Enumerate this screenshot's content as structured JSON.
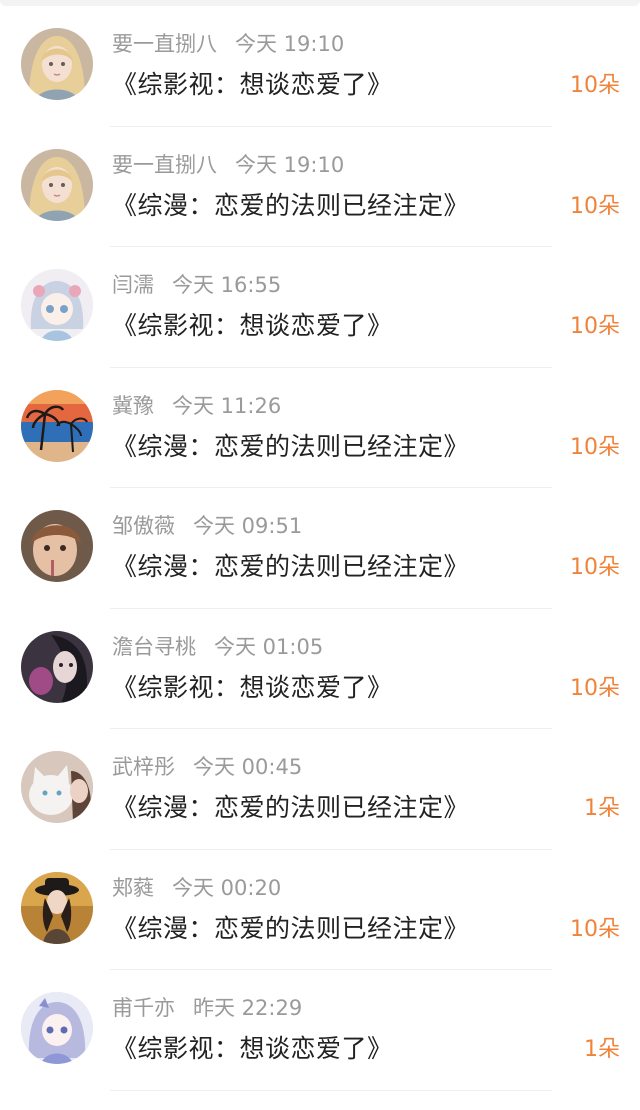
{
  "rows": [
    {
      "name": "要一直捌八",
      "time": "今天 19:10",
      "title": "《综影视：想谈恋爱了》",
      "gift": "10朵",
      "avatar": "avatar-girl-blonde"
    },
    {
      "name": "要一直捌八",
      "time": "今天 19:10",
      "title": "《综漫：恋爱的法则已经注定》",
      "gift": "10朵",
      "avatar": "avatar-girl-blonde"
    },
    {
      "name": "闫濡",
      "time": "今天 16:55",
      "title": "《综影视：想谈恋爱了》",
      "gift": "10朵",
      "avatar": "avatar-anime-girl"
    },
    {
      "name": "冀豫",
      "time": "今天 11:26",
      "title": "《综漫：恋爱的法则已经注定》",
      "gift": "10朵",
      "avatar": "avatar-palm-sunset"
    },
    {
      "name": "邹傲薇",
      "time": "今天 09:51",
      "title": "《综漫：恋爱的法则已经注定》",
      "gift": "10朵",
      "avatar": "avatar-child"
    },
    {
      "name": "澹台寻桃",
      "time": "今天 01:05",
      "title": "《综影视：想谈恋爱了》",
      "gift": "10朵",
      "avatar": "avatar-dark-portrait"
    },
    {
      "name": "武梓彤",
      "time": "今天 00:45",
      "title": "《综漫：恋爱的法则已经注定》",
      "gift": "1朵",
      "avatar": "avatar-cat"
    },
    {
      "name": "郏蕤",
      "time": "今天 00:20",
      "title": "《综漫：恋爱的法则已经注定》",
      "gift": "10朵",
      "avatar": "avatar-girl-hat"
    },
    {
      "name": "甫千亦",
      "time": "昨天 22:29",
      "title": "《综影视：想谈恋爱了》",
      "gift": "1朵",
      "avatar": "avatar-anime-lavender"
    }
  ],
  "colors": {
    "gift": "#f0833a",
    "meta": "#9a9a9a",
    "title": "#222222"
  }
}
